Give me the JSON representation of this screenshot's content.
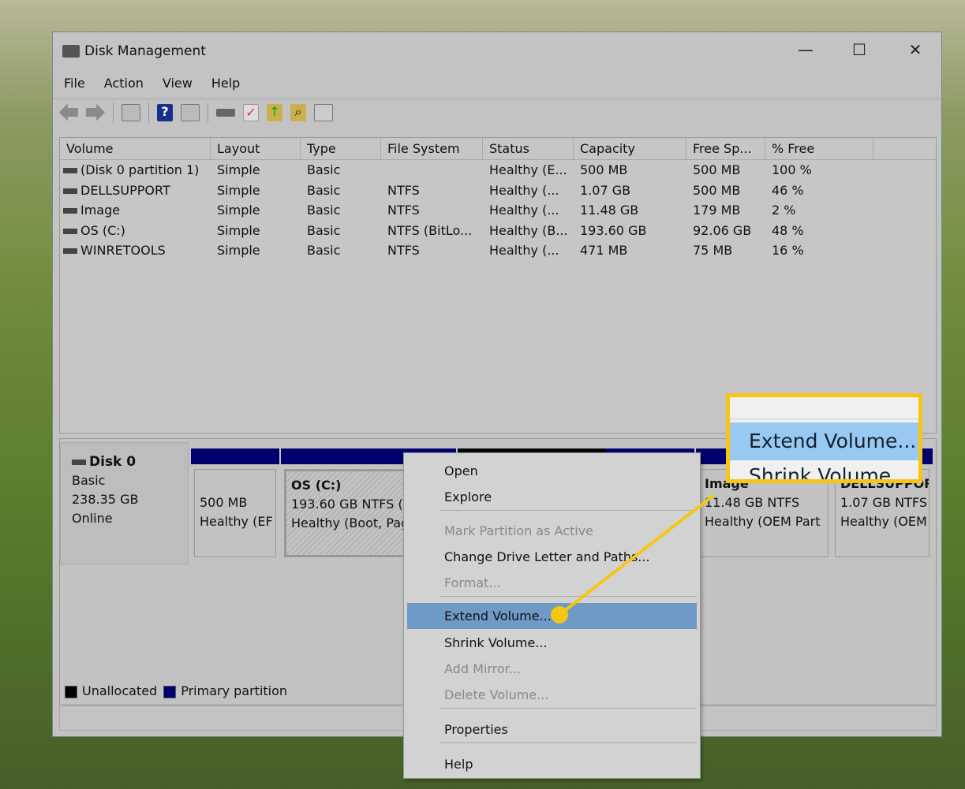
{
  "window": {
    "title": "Disk Management",
    "controls": [
      "—",
      "☐",
      "✕"
    ]
  },
  "menu": [
    "File",
    "Action",
    "View",
    "Help"
  ],
  "toolbar": [
    "back-icon",
    "forward-icon",
    "console-tree-icon",
    "help-icon",
    "action-pane-icon",
    "connect-icon",
    "check-icon",
    "folder-up-icon",
    "folder-search-icon",
    "properties-list-icon"
  ],
  "columns": [
    "Volume",
    "Layout",
    "Type",
    "File System",
    "Status",
    "Capacity",
    "Free Sp...",
    "% Free"
  ],
  "volumes": [
    [
      "(Disk 0 partition 1)",
      "Simple",
      "Basic",
      "",
      "Healthy (E...",
      "500 MB",
      "500 MB",
      "100 %"
    ],
    [
      "DELLSUPPORT",
      "Simple",
      "Basic",
      "NTFS",
      "Healthy (...",
      "1.07 GB",
      "500 MB",
      "46 %"
    ],
    [
      "Image",
      "Simple",
      "Basic",
      "NTFS",
      "Healthy (...",
      "11.48 GB",
      "179 MB",
      "2 %"
    ],
    [
      "OS (C:)",
      "Simple",
      "Basic",
      "NTFS (BitLo...",
      "Healthy (B...",
      "193.60 GB",
      "92.06 GB",
      "48 %"
    ],
    [
      "WINRETOOLS",
      "Simple",
      "Basic",
      "NTFS",
      "Healthy (...",
      "471 MB",
      "75 MB",
      "16 %"
    ]
  ],
  "disk": {
    "name": "Disk 0",
    "type": "Basic",
    "size": "238.35 GB",
    "state": "Online"
  },
  "partitions": [
    {
      "name": "",
      "size": "500 MB",
      "status": "Healthy (EF"
    },
    {
      "name": "OS  (C:)",
      "size": "193.60 GB NTFS (E",
      "status": "Healthy (Boot, Pag"
    },
    {
      "name": "Image",
      "size": "11.48 GB NTFS",
      "status": "Healthy (OEM Part"
    },
    {
      "name": "DELLSUPPORT",
      "size": "1.07 GB NTFS",
      "status": "Healthy (OEM"
    }
  ],
  "legend": [
    "Unallocated",
    "Primary partition"
  ],
  "context_menu": [
    {
      "label": "Open",
      "enabled": true
    },
    {
      "label": "Explore",
      "enabled": true
    },
    {
      "label": "Mark Partition as Active",
      "enabled": false
    },
    {
      "label": "Change Drive Letter and Paths...",
      "enabled": true
    },
    {
      "label": "Format...",
      "enabled": false
    },
    {
      "label": "Extend Volume...",
      "enabled": true,
      "highlighted": true
    },
    {
      "label": "Shrink Volume...",
      "enabled": true
    },
    {
      "label": "Add Mirror...",
      "enabled": false
    },
    {
      "label": "Delete Volume...",
      "enabled": false
    },
    {
      "label": "Properties",
      "enabled": true
    },
    {
      "label": "Help",
      "enabled": true
    }
  ],
  "callout": {
    "highlight": "Extend Volume...",
    "below": "Shrink Volume...",
    "color": "#f7c614"
  },
  "colors": {
    "primary": "#00006e",
    "unallocated": "#000000",
    "highlight": "#6f9ac6"
  }
}
